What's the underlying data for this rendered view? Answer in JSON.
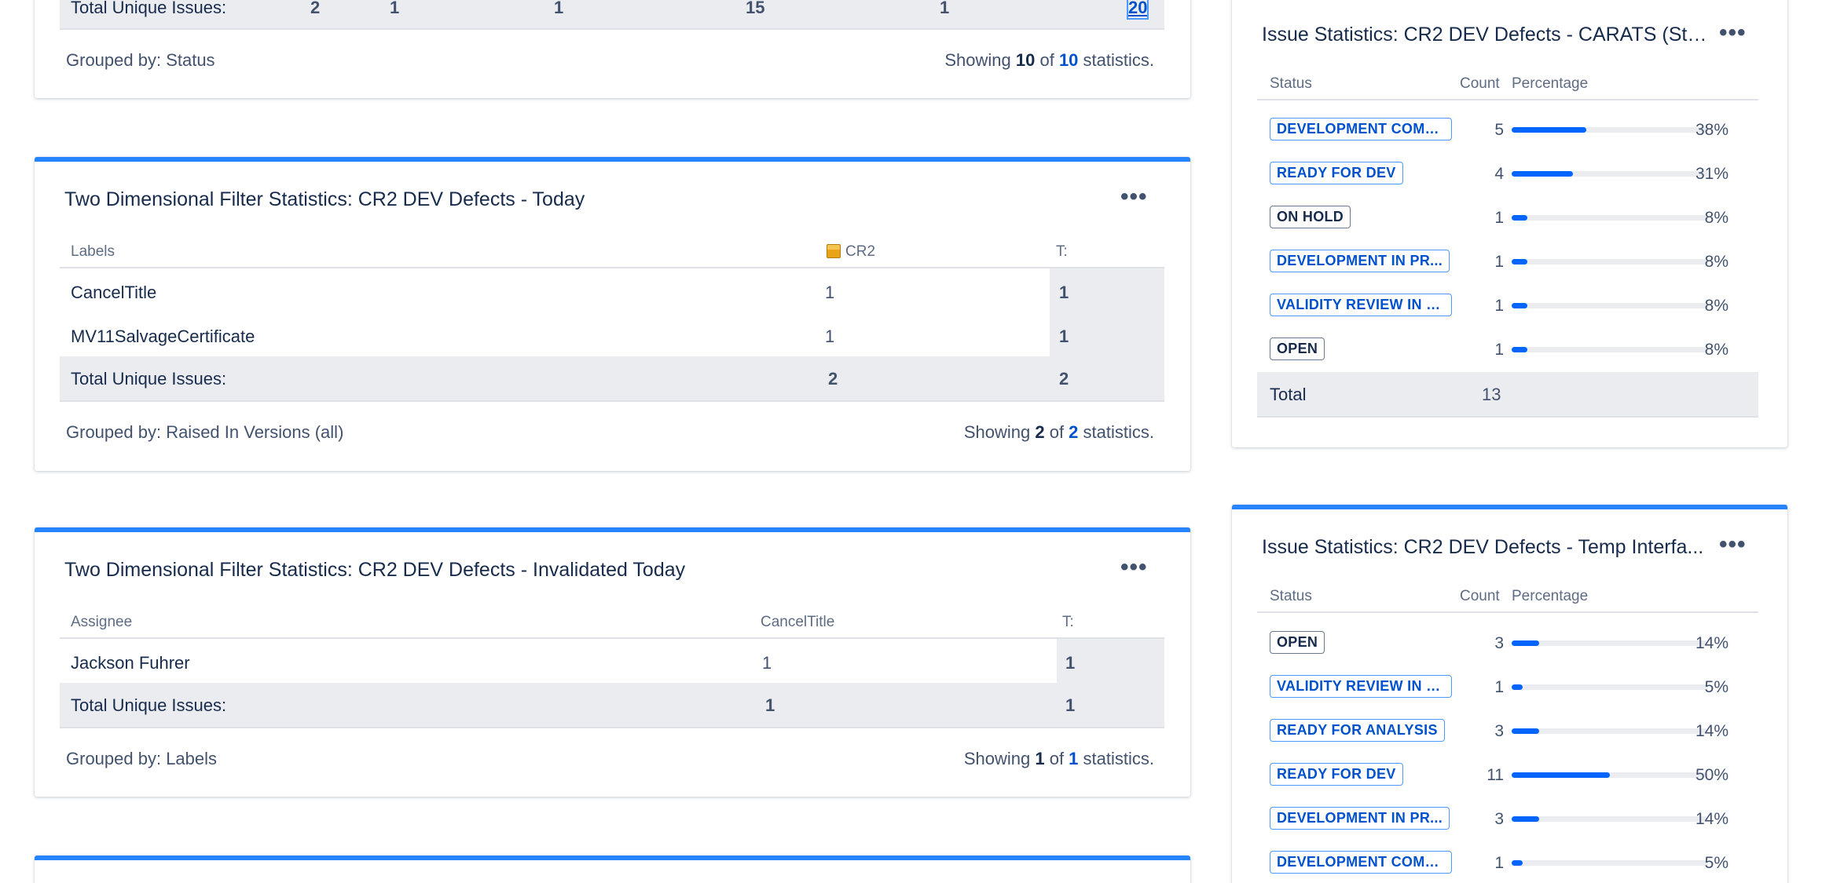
{
  "top_gadget": {
    "total_label": "Total Unique Issues:",
    "totals": [
      "2",
      "1",
      "1",
      "15",
      "1"
    ],
    "total_last": "20",
    "grouped_by": "Grouped by: Status",
    "showing": {
      "prefix": "Showing ",
      "shown": "10",
      "of": " of ",
      "total": "10",
      "suffix": " statistics."
    }
  },
  "gadget_today": {
    "title": "Two Dimensional Filter Statistics: CR2 DEV Defects - Today",
    "col_labels": "Labels",
    "col_cr2": "CR2",
    "col_t": "T:",
    "rows": [
      {
        "label": "CancelTitle",
        "cr2": "1",
        "t": "1"
      },
      {
        "label": "MV11SalvageCertificate",
        "cr2": "1",
        "t": "1"
      }
    ],
    "total_label": "Total Unique Issues:",
    "total_cr2": "2",
    "total_t": "2",
    "grouped_by": "Grouped by: Raised In Versions (all)",
    "showing": {
      "prefix": "Showing ",
      "shown": "2",
      "of": " of ",
      "total": "2",
      "suffix": " statistics."
    }
  },
  "gadget_invalidated": {
    "title": "Two Dimensional Filter Statistics: CR2 DEV Defects - Invalidated Today",
    "col_assignee": "Assignee",
    "col_cancel": "CancelTitle",
    "col_t": "T:",
    "rows": [
      {
        "assignee": "Jackson Fuhrer",
        "cancel": "1",
        "t": "1"
      }
    ],
    "total_label": "Total Unique Issues:",
    "total_cancel": "1",
    "total_t": "1",
    "grouped_by": "Grouped by: Labels",
    "showing": {
      "prefix": "Showing ",
      "shown": "1",
      "of": " of ",
      "total": "1",
      "suffix": " statistics."
    }
  },
  "gadget_carats": {
    "title": "Issue Statistics: CR2 DEV Defects - CARATS (Stat...",
    "col_status": "Status",
    "col_count": "Count",
    "col_pct": "Percentage",
    "rows": [
      {
        "status": "DEVELOPMENT COMP...",
        "count": "5",
        "pct": "38%",
        "frac": 0.38
      },
      {
        "status": "READY FOR DEV",
        "count": "4",
        "pct": "31%",
        "frac": 0.31
      },
      {
        "status": "ON HOLD",
        "count": "1",
        "pct": "8%",
        "frac": 0.08
      },
      {
        "status": "DEVELOPMENT IN PR...",
        "count": "1",
        "pct": "8%",
        "frac": 0.08
      },
      {
        "status": "VALIDITY REVIEW IN P...",
        "count": "1",
        "pct": "8%",
        "frac": 0.08
      },
      {
        "status": "OPEN",
        "count": "1",
        "pct": "8%",
        "frac": 0.08
      }
    ],
    "total_label": "Total",
    "total_count": "13"
  },
  "gadget_temp": {
    "title": "Issue Statistics: CR2 DEV Defects - Temp Interfa...",
    "col_status": "Status",
    "col_count": "Count",
    "col_pct": "Percentage",
    "rows": [
      {
        "status": "OPEN",
        "count": "3",
        "pct": "14%",
        "frac": 0.14
      },
      {
        "status": "VALIDITY REVIEW IN P...",
        "count": "1",
        "pct": "5%",
        "frac": 0.05
      },
      {
        "status": "READY FOR ANALYSIS",
        "count": "3",
        "pct": "14%",
        "frac": 0.14
      },
      {
        "status": "READY FOR DEV",
        "count": "11",
        "pct": "50%",
        "frac": 0.5
      },
      {
        "status": "DEVELOPMENT IN PR...",
        "count": "3",
        "pct": "14%",
        "frac": 0.14
      },
      {
        "status": "DEVELOPMENT COMP...",
        "count": "1",
        "pct": "5%",
        "frac": 0.05
      }
    ]
  },
  "icons": {
    "more": "more-horizontal-icon",
    "version": "package-icon"
  },
  "colors": {
    "accent": "#2684ff",
    "bar": "#0065ff",
    "link": "#0052cc"
  }
}
